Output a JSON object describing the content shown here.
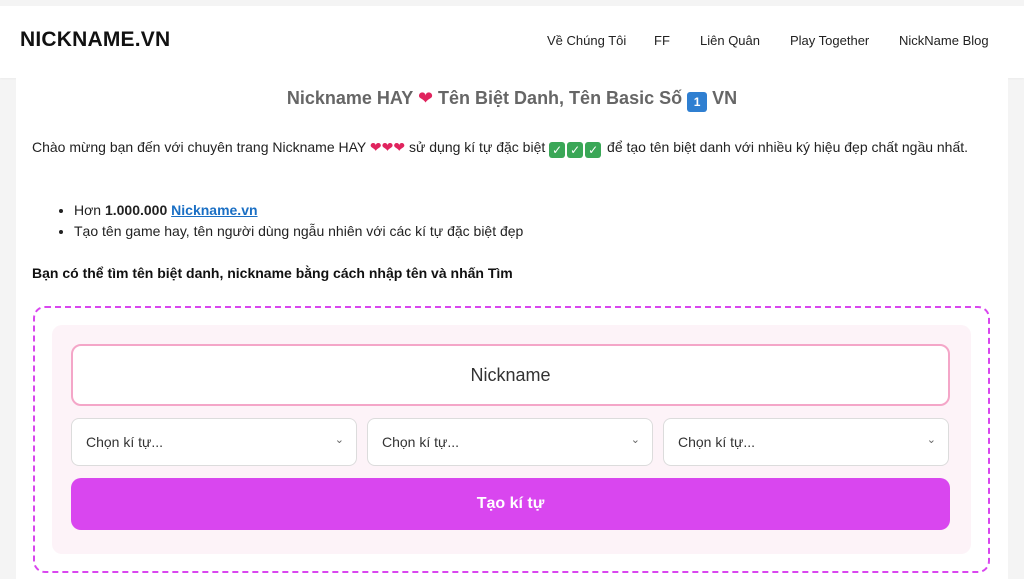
{
  "site": {
    "logo": "NICKNAME.VN"
  },
  "nav": {
    "items": [
      {
        "label": "Về Chúng Tôi"
      },
      {
        "label": "FF"
      },
      {
        "label": "Liên Quân"
      },
      {
        "label": "Play Together"
      },
      {
        "label": "NickName Blog"
      }
    ]
  },
  "page": {
    "title_part1": "Nickname HAY",
    "title_heart": "❤",
    "title_part2": "Tên Biệt Danh, Tên Basic Số",
    "title_badge": "1",
    "title_part3": "VN",
    "intro_part1": "Chào mừng bạn đến với chuyên trang Nickname HAY",
    "intro_hearts": "❤❤❤",
    "intro_part2": "sử dụng kí tự đặc biệt",
    "intro_check": "✓",
    "intro_part3": "để tạo tên biệt danh với nhiều ký hiệu đẹp chất ngầu nhất.",
    "bullet1_prefix": "Hơn",
    "bullet1_count": "1.000.000",
    "bullet1_link": "Nickname.vn",
    "bullet2": "Tạo tên game hay, tên người dùng ngẫu nhiên với các kí tự đặc biệt đẹp",
    "prompt": "Bạn có thể tìm tên biệt danh, nickname bằng cách nhập tên và nhấn Tìm"
  },
  "tool": {
    "input_placeholder": "Nickname",
    "selects": [
      {
        "value": "Chọn kí tự..."
      },
      {
        "value": "Chọn kí tự..."
      },
      {
        "value": "Chọn kí tự..."
      }
    ],
    "button_label": "Tạo kí tự"
  },
  "colors": {
    "accent": "#d946ef",
    "input_border": "#f4a6c8",
    "tool_bg": "#fdf3f8",
    "link": "#1a6fc4",
    "heart": "#e0245e",
    "check": "#3aa757",
    "badge": "#2f7fd1"
  }
}
